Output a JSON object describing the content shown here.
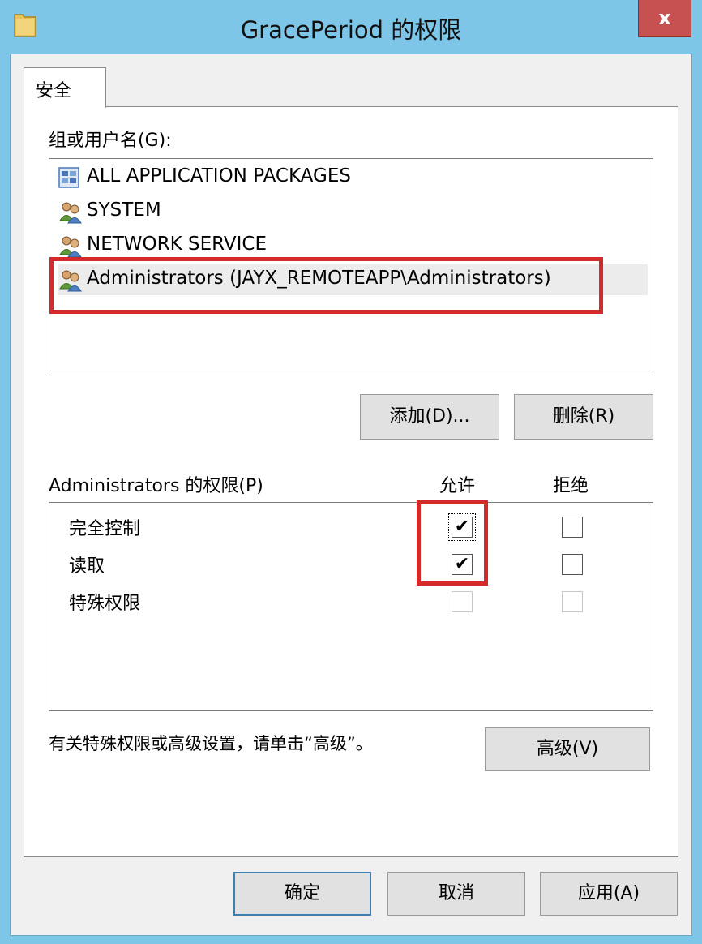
{
  "window": {
    "title": "GracePeriod 的权限",
    "close_label": "x"
  },
  "tab": {
    "label": "安全"
  },
  "users_section": {
    "label": "组或用户名(G):",
    "items": [
      {
        "label": "ALL APPLICATION PACKAGES",
        "icon": "app-packages-icon"
      },
      {
        "label": "SYSTEM",
        "icon": "users-icon"
      },
      {
        "label": "NETWORK SERVICE",
        "icon": "users-icon"
      },
      {
        "label": "Administrators (JAYX_REMOTEAPP\\Administrators)",
        "icon": "users-icon",
        "selected": true
      }
    ],
    "add_button": "添加(D)...",
    "remove_button": "删除(R)"
  },
  "permissions": {
    "label": "Administrators 的权限(P)",
    "allow_header": "允许",
    "deny_header": "拒绝",
    "rows": [
      {
        "label": "完全控制",
        "allow": true,
        "deny": false,
        "enabled": true
      },
      {
        "label": "读取",
        "allow": true,
        "deny": false,
        "enabled": true
      },
      {
        "label": "特殊权限",
        "allow": false,
        "deny": false,
        "enabled": false
      }
    ]
  },
  "advanced": {
    "hint": "有关特殊权限或高级设置，请单击“高级”。",
    "button": "高级(V)"
  },
  "footer": {
    "ok": "确定",
    "cancel": "取消",
    "apply": "应用(A)"
  },
  "colors": {
    "title_bar": "#7ec6e8",
    "close_button": "#c75050",
    "highlight_box": "#d42a2a"
  }
}
